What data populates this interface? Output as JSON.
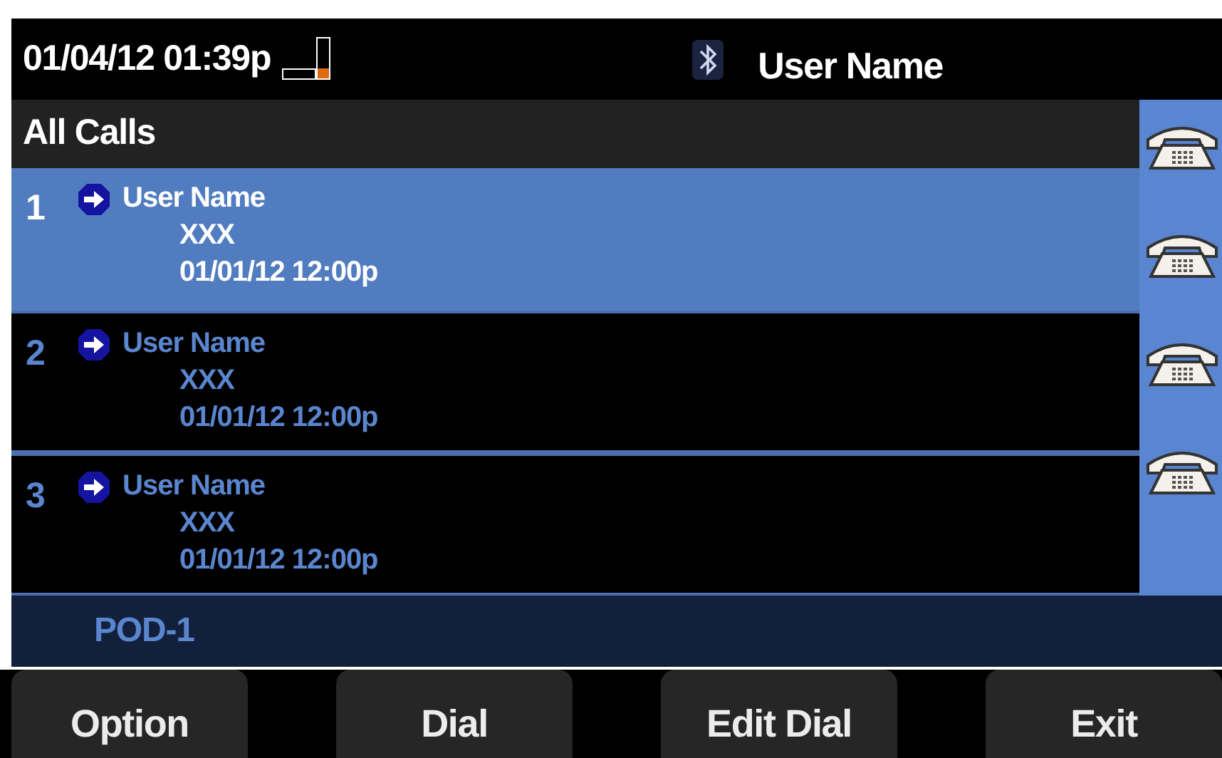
{
  "status_bar": {
    "datetime": "01/04/12 01:39p",
    "user": "User Name"
  },
  "header": {
    "title": "All Calls"
  },
  "calls": [
    {
      "index": "1",
      "name": "User Name",
      "number": "XXX",
      "time": "01/01/12 12:00p",
      "selected": true
    },
    {
      "index": "2",
      "name": "User Name",
      "number": "XXX",
      "time": "01/01/12 12:00p",
      "selected": false
    },
    {
      "index": "3",
      "name": "User Name",
      "number": "XXX",
      "time": "01/01/12 12:00p",
      "selected": false
    }
  ],
  "footer": {
    "label": "POD-1"
  },
  "softkeys": [
    "Option",
    "Dial",
    "Edit Dial",
    "Exit"
  ]
}
